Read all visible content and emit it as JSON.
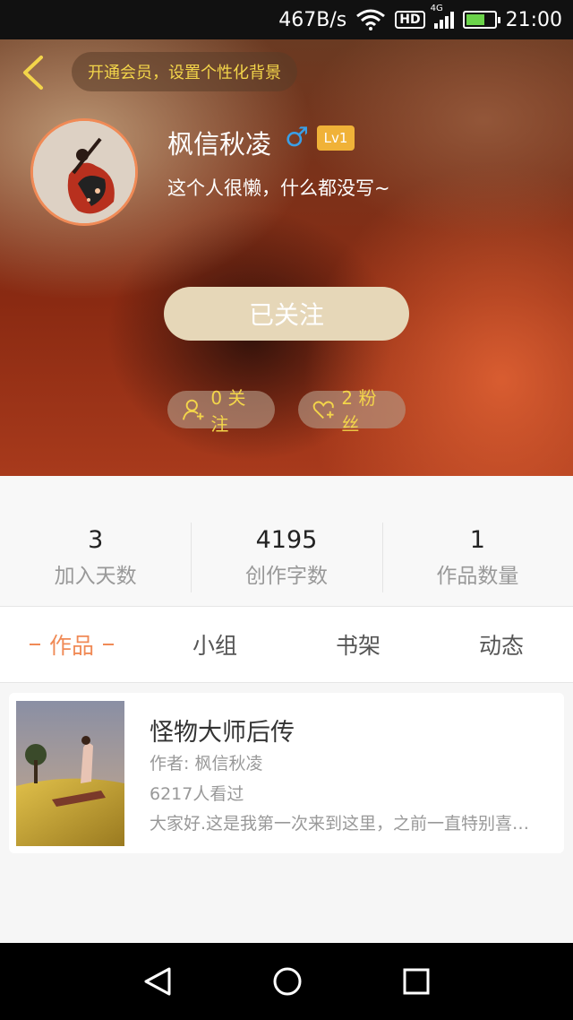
{
  "status_bar": {
    "speed": "467B/s",
    "hd": "HD",
    "network": "4G",
    "time": "21:00"
  },
  "header": {
    "vip_prompt": "开通会员，设置个性化背景",
    "username": "枫信秋凌",
    "gender_symbol": "♂",
    "level": "Lv1",
    "bio": "这个人很懒，什么都没写~",
    "follow_state": "已关注",
    "following_label": "0 关注",
    "fans_label": "2 粉丝"
  },
  "stats": [
    {
      "value": "3",
      "label": "加入天数"
    },
    {
      "value": "4195",
      "label": "创作字数"
    },
    {
      "value": "1",
      "label": "作品数量"
    }
  ],
  "tabs": [
    "作品",
    "小组",
    "书架",
    "动态"
  ],
  "works": [
    {
      "title": "怪物大师后传",
      "author": "作者: 枫信秋凌",
      "views": "6217人看过",
      "description": "大家好.这是我第一次来到这里，之前一直特别喜欢..."
    }
  ],
  "colors": {
    "accent": "#f08a56",
    "gold": "#f3d54a",
    "gender_blue": "#3aa0e8",
    "level_badge": "#f0b238"
  },
  "icons": {
    "back": "chevron-left-icon",
    "follow": "user-plus-icon",
    "fans": "heart-plus-icon",
    "nav_back": "triangle-back-icon",
    "nav_home": "circle-home-icon",
    "nav_recent": "square-recent-icon"
  }
}
